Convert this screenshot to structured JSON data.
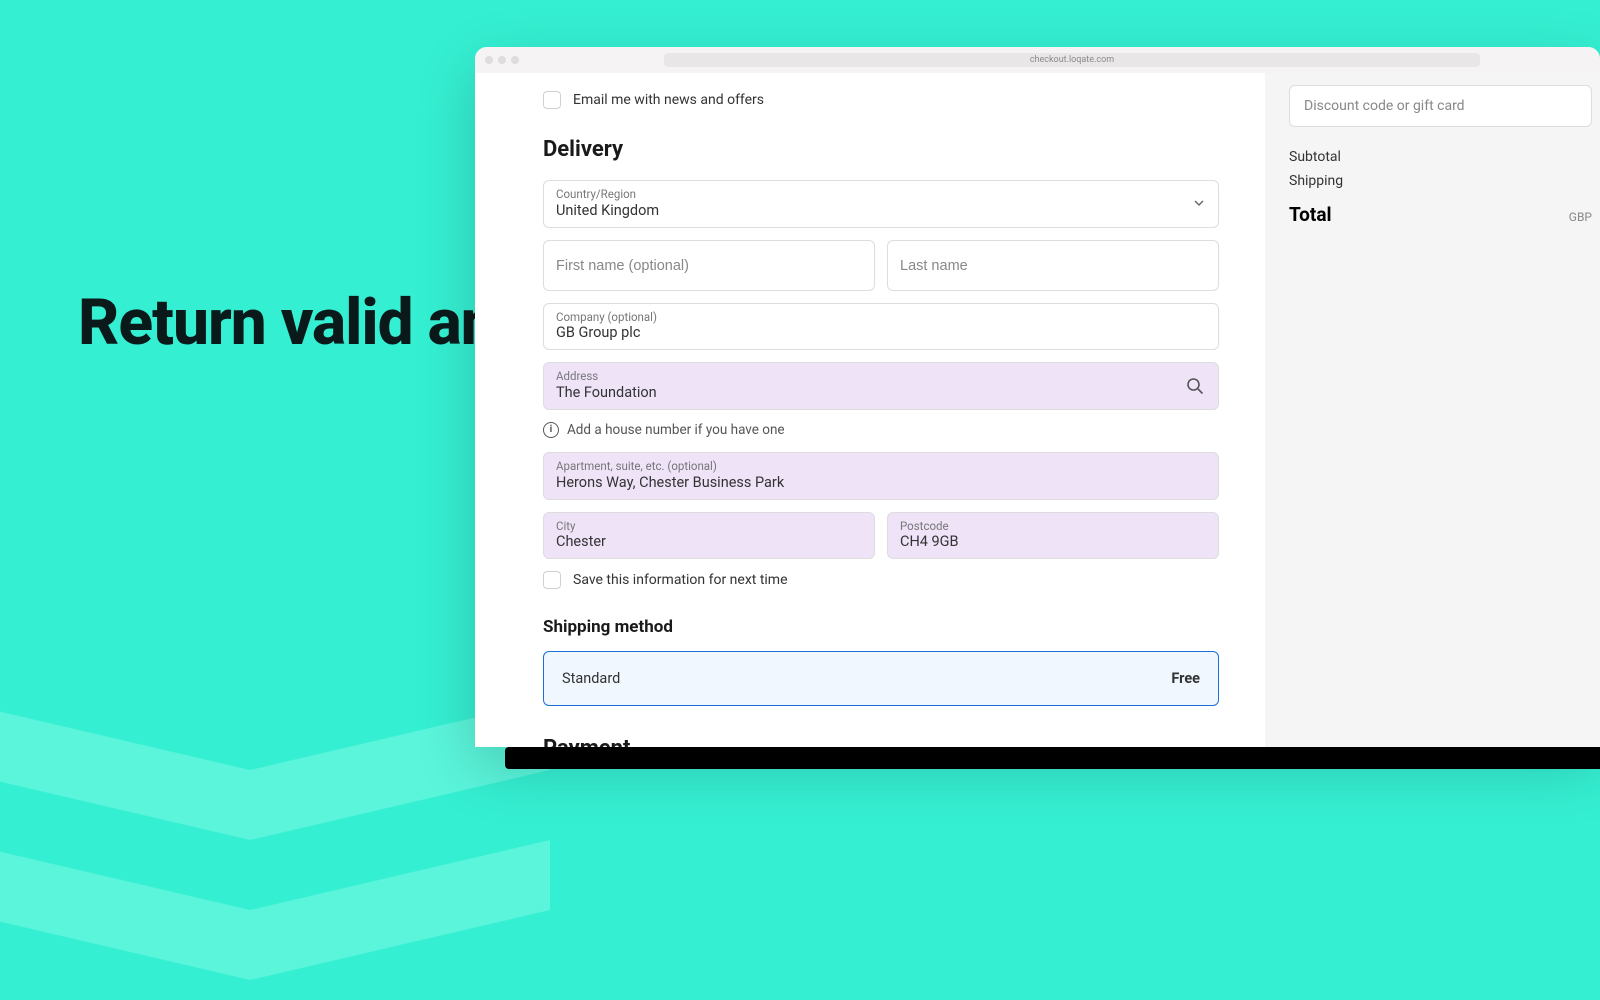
{
  "headline": "Return valid and complete addresses",
  "browser": {
    "url": "checkout.loqate.com"
  },
  "form": {
    "email_news_label": "Email me with news and offers",
    "delivery_heading": "Delivery",
    "country": {
      "label": "Country/Region",
      "value": "United Kingdom"
    },
    "first_name": {
      "placeholder": "First name (optional)",
      "value": ""
    },
    "last_name": {
      "placeholder": "Last name",
      "value": ""
    },
    "company": {
      "label": "Company (optional)",
      "value": "GB Group plc"
    },
    "address": {
      "label": "Address",
      "value": "The Foundation"
    },
    "house_hint": "Add a house number if you have one",
    "apt": {
      "label": "Apartment, suite, etc. (optional)",
      "value": "Herons Way, Chester Business Park"
    },
    "city": {
      "label": "City",
      "value": "Chester"
    },
    "postcode": {
      "label": "Postcode",
      "value": "CH4 9GB"
    },
    "save_info_label": "Save this information for next time",
    "shipping_heading": "Shipping method",
    "shipping_option": {
      "name": "Standard",
      "price": "Free"
    },
    "payment_heading": "Payment"
  },
  "order": {
    "discount_placeholder": "Discount code or gift card",
    "subtotal_label": "Subtotal",
    "shipping_label": "Shipping",
    "total_label": "Total",
    "currency": "GBP"
  }
}
